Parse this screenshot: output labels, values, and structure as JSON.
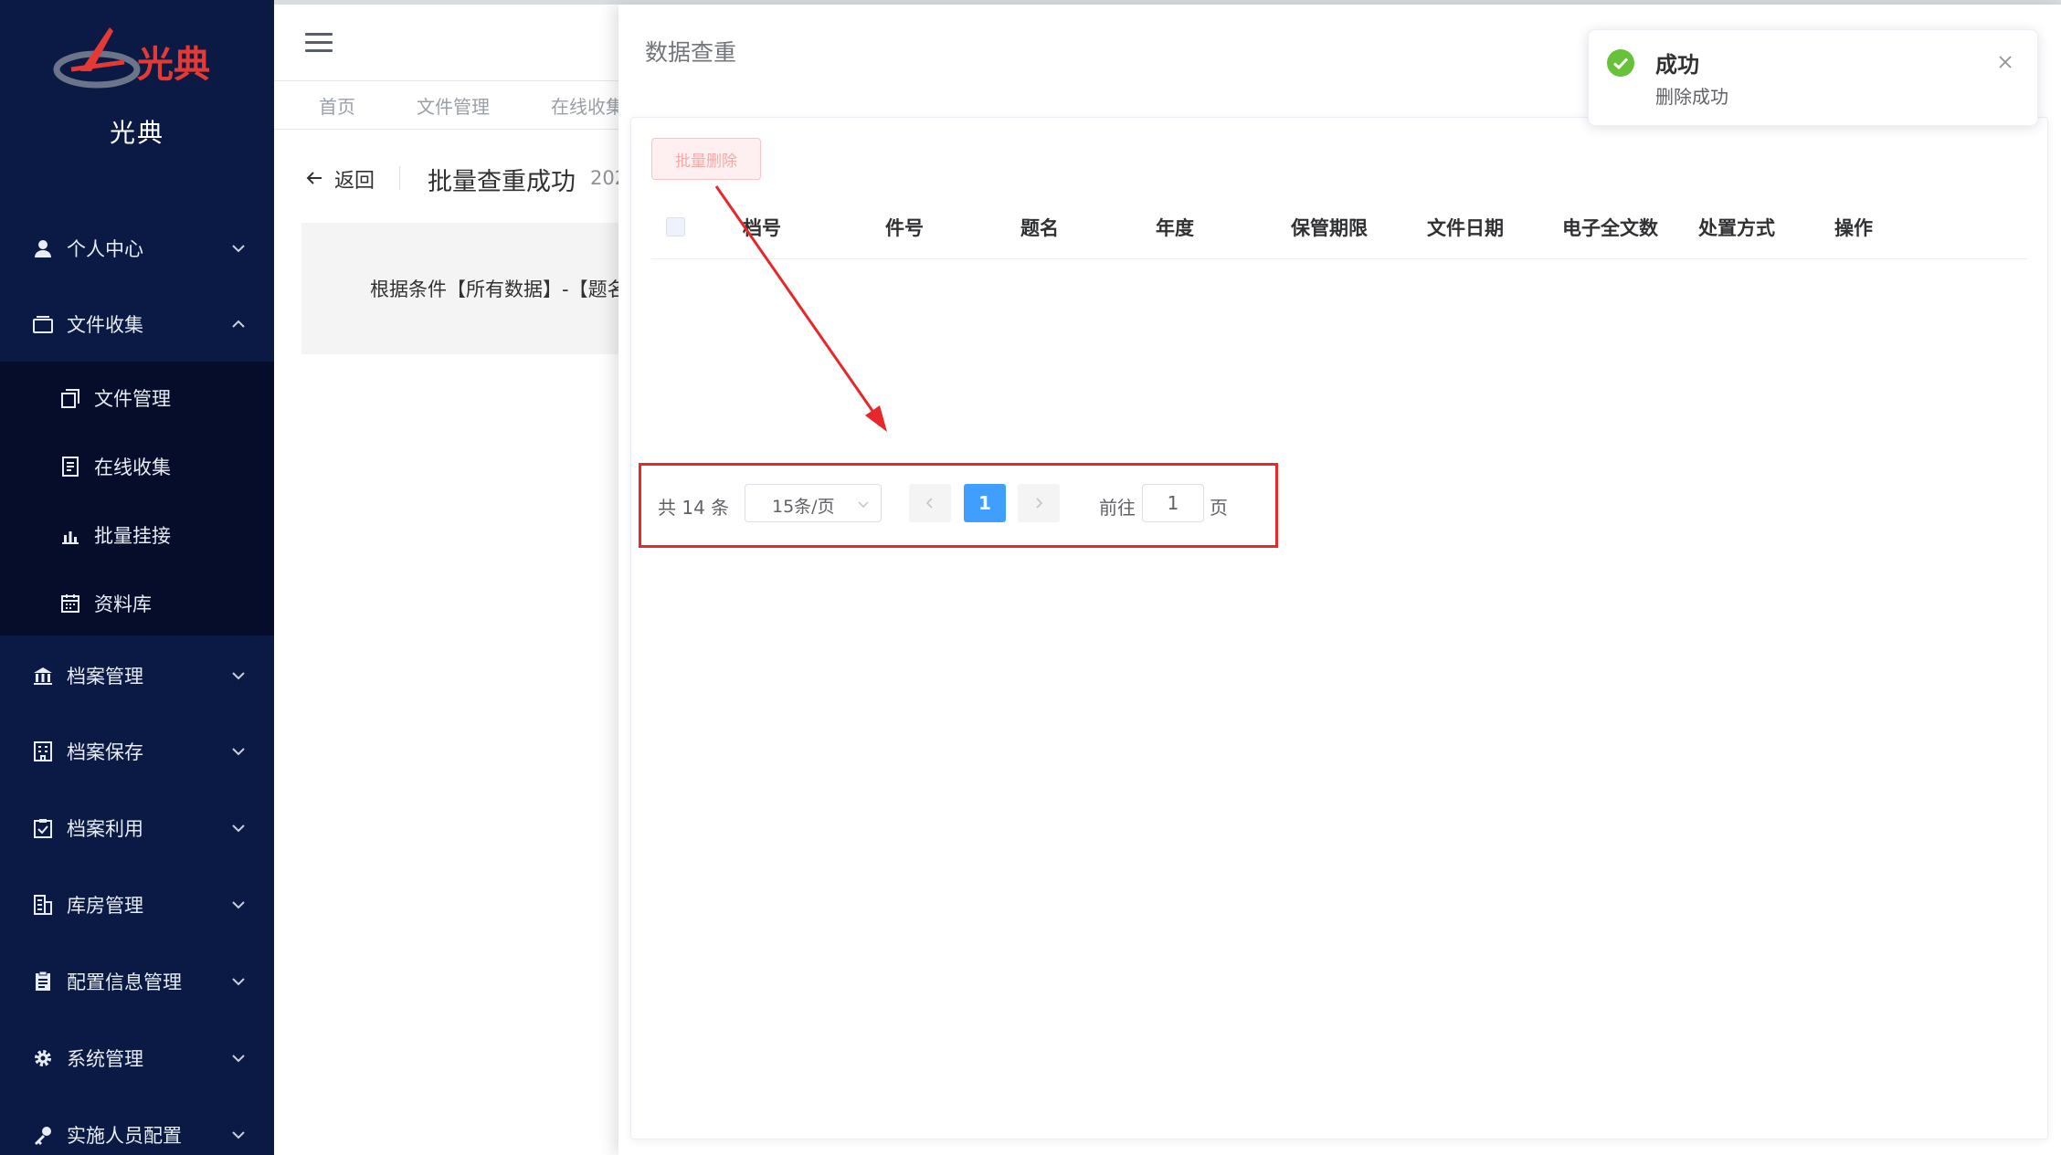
{
  "brand": {
    "logo_text": "光典",
    "name": "光典"
  },
  "sidebar": {
    "menu": [
      {
        "label": "个人中心",
        "icon": "user-icon",
        "expanded": false
      },
      {
        "label": "文件收集",
        "icon": "folder-icon",
        "expanded": true
      },
      {
        "label": "档案管理",
        "icon": "bank-icon",
        "expanded": false
      },
      {
        "label": "档案保存",
        "icon": "building-icon",
        "expanded": false
      },
      {
        "label": "档案利用",
        "icon": "clipboard-check-icon",
        "expanded": false
      },
      {
        "label": "库房管理",
        "icon": "warehouse-icon",
        "expanded": false
      },
      {
        "label": "配置信息管理",
        "icon": "document-list-icon",
        "expanded": false
      },
      {
        "label": "系统管理",
        "icon": "gear-icon",
        "expanded": false
      },
      {
        "label": "实施人员配置",
        "icon": "key-icon",
        "expanded": false
      }
    ],
    "submenu": [
      {
        "label": "文件管理",
        "icon": "copy-icon"
      },
      {
        "label": "在线收集",
        "icon": "document-icon"
      },
      {
        "label": "批量挂接",
        "icon": "bar-chart-icon"
      },
      {
        "label": "资料库",
        "icon": "calendar-icon"
      }
    ]
  },
  "tabs": [
    "首页",
    "文件管理",
    "在线收集"
  ],
  "page": {
    "back_label": "返回",
    "title": "批量查重成功",
    "date_fragment": "202",
    "info_text": "根据条件【所有数据】-【题名"
  },
  "drawer": {
    "title": "数据查重",
    "batch_delete_label": "批量删除",
    "columns": [
      "档号",
      "件号",
      "题名",
      "年度",
      "保管期限",
      "文件日期",
      "电子全文数",
      "处置方式",
      "操作"
    ],
    "rows": []
  },
  "pagination": {
    "total_label": "共 14 条",
    "page_size_label": "15条/页",
    "current_page": "1",
    "goto_label": "前往",
    "goto_value": "1",
    "page_suffix": "页"
  },
  "toast": {
    "title": "成功",
    "message": "删除成功",
    "type": "success"
  },
  "colors": {
    "sidebar_bg": "#0b1a45",
    "submenu_bg": "#060d2a",
    "primary": "#409eff",
    "danger_light": "#fef0f0",
    "success": "#67c23a",
    "annotation_red": "#e8272a"
  }
}
